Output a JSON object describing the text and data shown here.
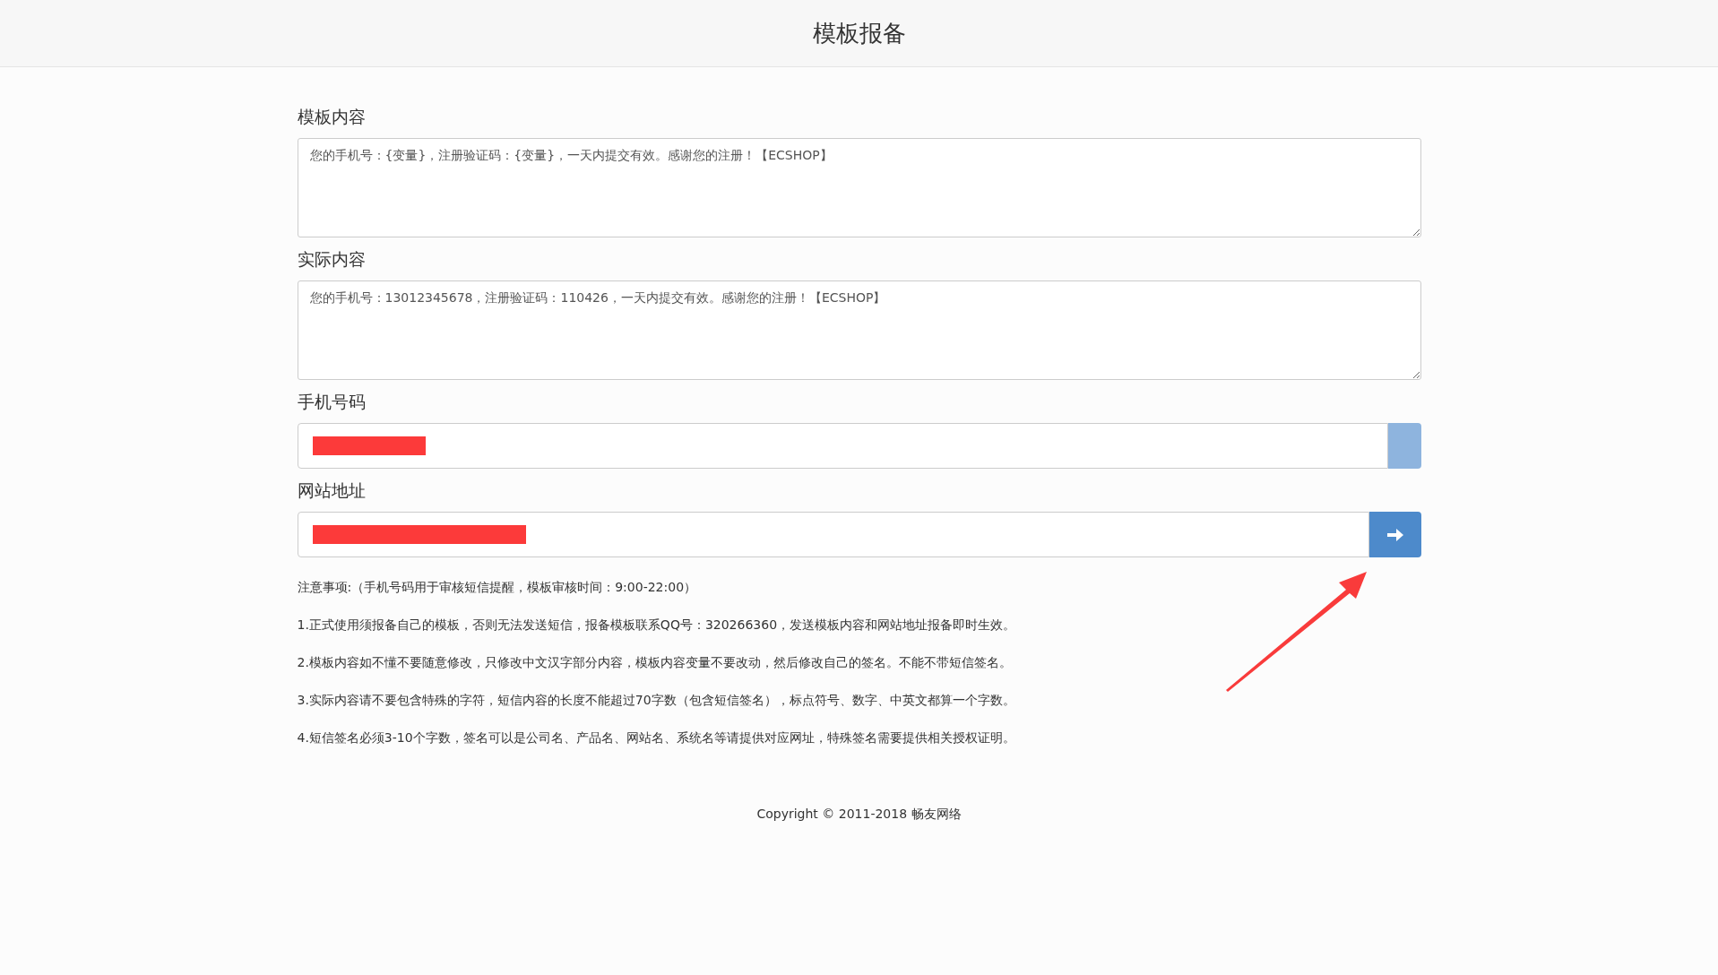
{
  "header": {
    "title": "模板报备"
  },
  "fields": [
    {
      "kind": "textarea",
      "label": "模板内容",
      "value": "您的手机号：{变量}，注册验证码：{变量}，一天内提交有效。感谢您的注册！【ECSHOP】"
    },
    {
      "kind": "textarea",
      "label": "实际内容",
      "value": "您的手机号：13012345678，注册验证码：110426，一天内提交有效。感谢您的注册！【ECSHOP】"
    },
    {
      "kind": "input",
      "label": "手机号码",
      "redacted": true,
      "addon": {
        "kind": "blank",
        "disabled": true
      }
    },
    {
      "kind": "input",
      "label": "网站地址",
      "redacted": true,
      "addon": {
        "kind": "submit",
        "disabled": false
      }
    }
  ],
  "notes": [
    "注意事项:（手机号码用于审核短信提醒，模板审核时间：9:00-22:00）",
    "1.正式使用须报备自己的模板，否则无法发送短信，报备模板联系QQ号：320266360，发送模板内容和网站地址报备即时生效。",
    "2.模板内容如不懂不要随意修改，只修改中文汉字部分内容，模板内容变量不要改动，然后修改自己的签名。不能不带短信签名。",
    "3.实际内容请不要包含特殊的字符，短信内容的长度不能超过70字数（包含短信签名），标点符号、数字、中英文都算一个字数。",
    "4.短信签名必须3-10个字数，签名可以是公司名、产品名、网站名、系统名等请提供对应网址，特殊签名需要提供相关授权证明。"
  ],
  "footer": {
    "copyright": "Copyright © 2011-2018 畅友网络"
  }
}
